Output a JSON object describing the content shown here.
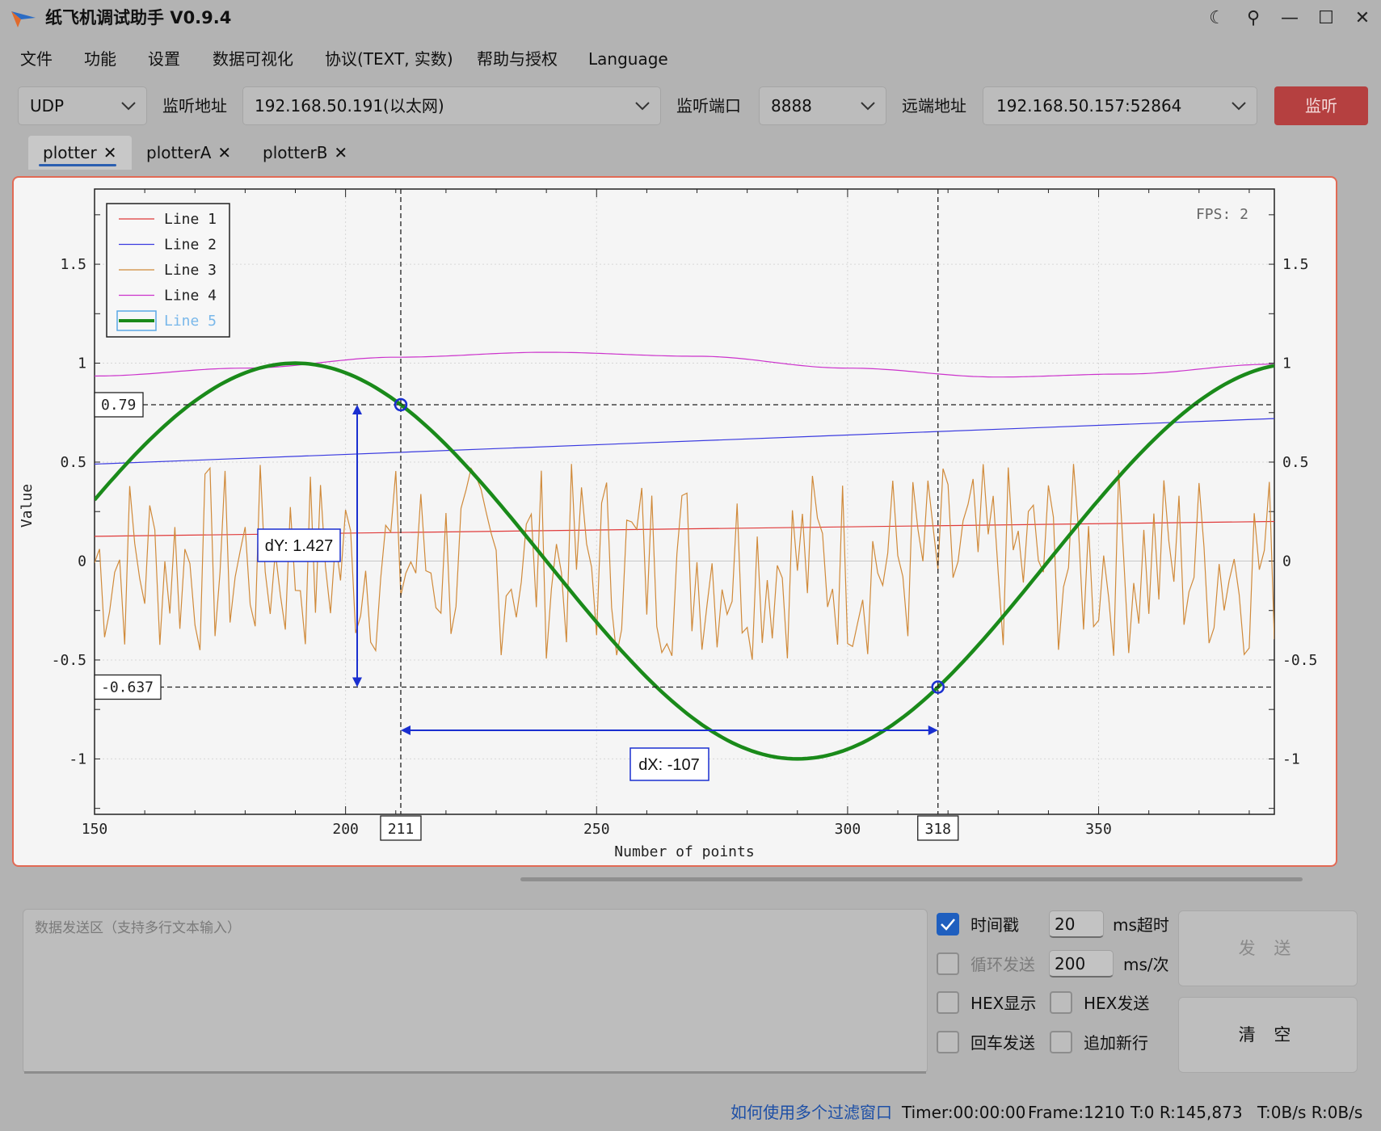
{
  "window": {
    "title": "纸飞机调试助手 V0.9.4",
    "controls": {
      "theme": "☾",
      "pin": "⚲",
      "minimize": "—",
      "maximize": "☐",
      "close": "✕"
    }
  },
  "menu": [
    "文件",
    "功能",
    "设置",
    "数据可视化",
    "协议(TEXT, 实数)",
    "帮助与授权",
    "Language"
  ],
  "toolbar": {
    "protocol": "UDP",
    "listen_address_label": "监听地址",
    "listen_address": "192.168.50.191(以太网)",
    "listen_port_label": "监听端口",
    "listen_port": "8888",
    "remote_address_label": "远端地址",
    "remote_address": "192.168.50.157:52864",
    "listen_button": "监听",
    "listen_button_color": "#b54040"
  },
  "tabs": [
    {
      "label": "plotter",
      "active": true
    },
    {
      "label": "plotterA",
      "active": false
    },
    {
      "label": "plotterB",
      "active": false
    }
  ],
  "plot": {
    "fps": "FPS: 2",
    "xlabel": "Number of points",
    "ylabel": "Value",
    "cursor1": {
      "x": 211,
      "y": 0.79,
      "x_label": "211",
      "y_label": "0.79"
    },
    "cursor2": {
      "x": 318,
      "y": -0.637,
      "x_label": "318",
      "y_label": "-0.637"
    },
    "dy_label": "dY: 1.427",
    "dx_label": "dX: -107"
  },
  "chart_data": {
    "type": "line",
    "xlim": [
      150,
      385
    ],
    "ylim": [
      -1.28,
      1.88
    ],
    "x_ticks": [
      "150",
      "200",
      "250",
      "300",
      "350"
    ],
    "x_tick_values": [
      150,
      200,
      250,
      300,
      350
    ],
    "y_ticks": [
      "1.5",
      "1",
      "0.5",
      "0",
      "-0.5",
      "-1"
    ],
    "y_tick_values": [
      1.5,
      1,
      0.5,
      0,
      -0.5,
      -1
    ],
    "grid": true,
    "legend_position": "top-left",
    "series": [
      {
        "name": "Line 1",
        "color": "#e03a3a",
        "points": [
          [
            150,
            0.125
          ],
          [
            385,
            0.2
          ]
        ]
      },
      {
        "name": "Line 2",
        "color": "#3a3ae0",
        "points": [
          [
            150,
            0.49
          ],
          [
            385,
            0.72
          ]
        ]
      },
      {
        "name": "Line 3",
        "color": "#d08a3a",
        "noise": {
          "min": -0.5,
          "max": 0.5,
          "step": 1
        }
      },
      {
        "name": "Line 4",
        "color": "#cc33cc",
        "points": [
          [
            150,
            0.935
          ],
          [
            180,
            0.975
          ],
          [
            210,
            1.03
          ],
          [
            240,
            1.055
          ],
          [
            270,
            1.035
          ],
          [
            300,
            0.975
          ],
          [
            330,
            0.93
          ],
          [
            355,
            0.945
          ],
          [
            385,
            0.995
          ]
        ]
      },
      {
        "name": "Line 5",
        "color": "#1a8a1a",
        "sine": {
          "amplitude": 1,
          "period": 200,
          "peak_x": 190
        },
        "hidden": true
      }
    ]
  },
  "send": {
    "placeholder": "数据发送区（支持多行文本输入）",
    "timestamp_label": "时间戳",
    "timestamp_checked": true,
    "timeout_value": "20",
    "timeout_unit": "ms超时",
    "loop_label": "循环发送",
    "loop_checked": false,
    "interval_value": "200",
    "interval_unit": "ms/次",
    "hex_display_label": "HEX显示",
    "hex_send_label": "HEX发送",
    "enter_send_label": "回车发送",
    "append_newline_label": "追加新行",
    "send_button": "发 送",
    "clear_button": "清 空"
  },
  "status": {
    "filter_link": "如何使用多个过滤窗口",
    "timer": "Timer:00:00:00",
    "frame": "Frame:1210",
    "tr": "T:0 R:145,873",
    "rate": "T:0B/s R:0B/s"
  }
}
